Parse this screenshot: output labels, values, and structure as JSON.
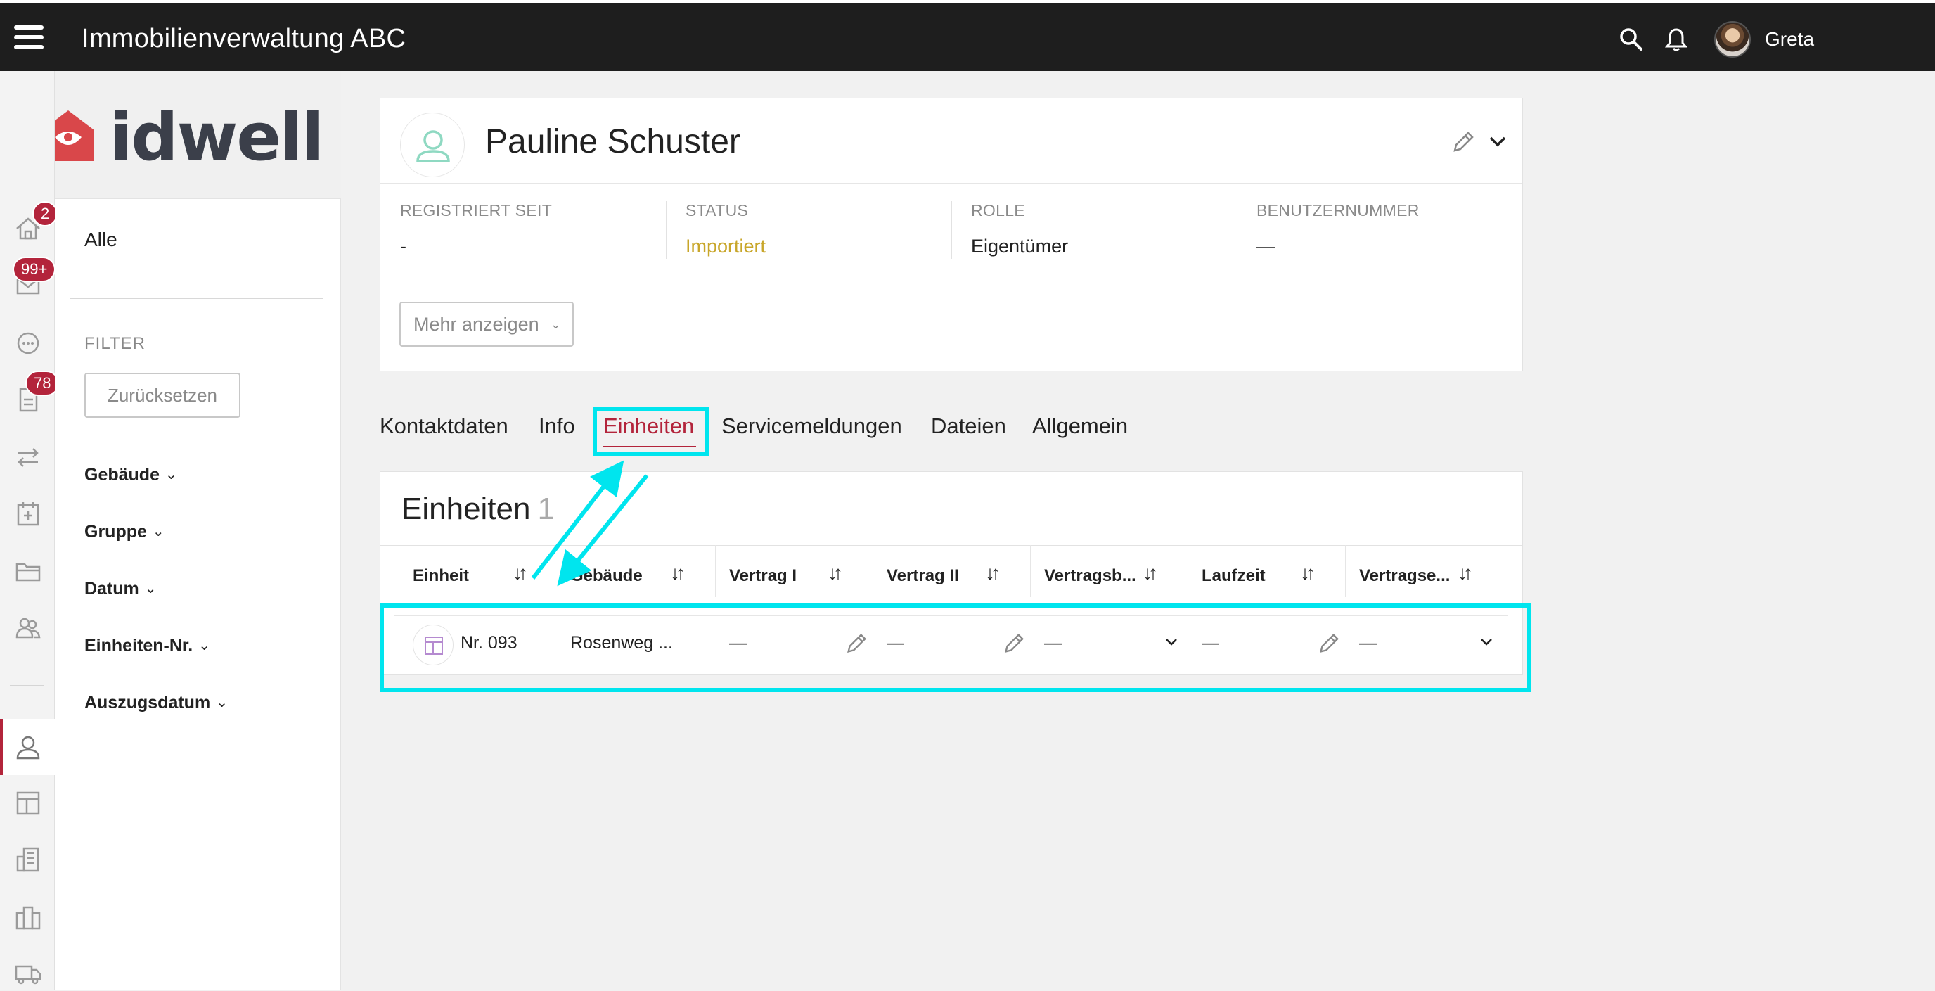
{
  "header": {
    "app_title": "Immobilienverwaltung ABC",
    "user_name": "Greta"
  },
  "brand": {
    "logo_text": "idwell"
  },
  "rail": {
    "badges": {
      "home": "2",
      "mail": "99+",
      "documents": "78"
    }
  },
  "filter_panel": {
    "all_label": "Alle",
    "filter_heading": "FILTER",
    "reset_label": "Zurücksetzen",
    "groups": [
      "Gebäude",
      "Gruppe",
      "Datum",
      "Einheiten-Nr.",
      "Auszugsdatum"
    ]
  },
  "profile": {
    "name": "Pauline Schuster",
    "fields": [
      {
        "label": "REGISTRIERT SEIT",
        "value": "-"
      },
      {
        "label": "STATUS",
        "value": "Importiert"
      },
      {
        "label": "ROLLE",
        "value": "Eigentümer"
      },
      {
        "label": "BENUTZERNUMMER",
        "value": "—"
      }
    ],
    "more_label": "Mehr anzeigen"
  },
  "tabs": [
    "Kontaktdaten",
    "Info",
    "Einheiten",
    "Servicemeldungen",
    "Dateien",
    "Allgemein"
  ],
  "active_tab": "Einheiten",
  "units": {
    "title": "Einheiten",
    "count": "1",
    "columns": [
      "Einheit",
      "Gebäude",
      "Vertrag I",
      "Vertrag II",
      "Vertragsb...",
      "Laufzeit",
      "Vertragse..."
    ],
    "sort_glyph": "↓↑",
    "rows": [
      {
        "unit": "Nr. 093",
        "building": "Rosenweg ...",
        "contract1": "—",
        "contract2": "—",
        "contract_start": "—",
        "term": "—",
        "contract_end": "—"
      }
    ]
  },
  "colors": {
    "accent": "#b3243b",
    "status_imported": "#c8a62a",
    "annotation": "#00e5ee",
    "topbar": "#1e1e1e"
  }
}
